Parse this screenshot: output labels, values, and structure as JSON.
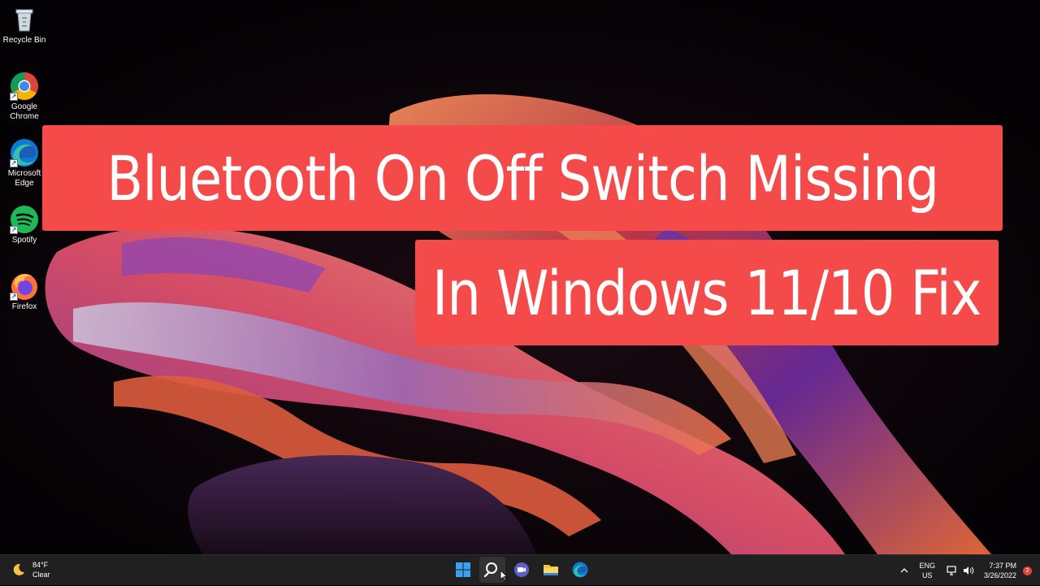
{
  "desktop": {
    "icons": [
      {
        "label": "Recycle Bin"
      },
      {
        "label": "Google Chrome"
      },
      {
        "label": "Microsoft Edge"
      },
      {
        "label": "Spotify"
      },
      {
        "label": "Firefox"
      }
    ]
  },
  "overlay": {
    "line1": "Bluetooth On Off Switch Missing",
    "line2": "In Windows 11/10 Fix",
    "banner_color": "#f44a4a"
  },
  "taskbar": {
    "weather": {
      "temperature": "84°F",
      "condition": "Clear",
      "icon": "moon-icon"
    },
    "pinned": [
      {
        "name": "start-button",
        "icon": "windows-logo-icon"
      },
      {
        "name": "search-button",
        "icon": "search-icon"
      },
      {
        "name": "chat-button",
        "icon": "teams-chat-icon"
      },
      {
        "name": "file-explorer-button",
        "icon": "folder-icon"
      },
      {
        "name": "edge-button",
        "icon": "edge-icon"
      }
    ],
    "tray": {
      "lang_top": "ENG",
      "lang_bottom": "US",
      "time": "7:37 PM",
      "date": "3/26/2022",
      "notification_count": "2"
    }
  }
}
